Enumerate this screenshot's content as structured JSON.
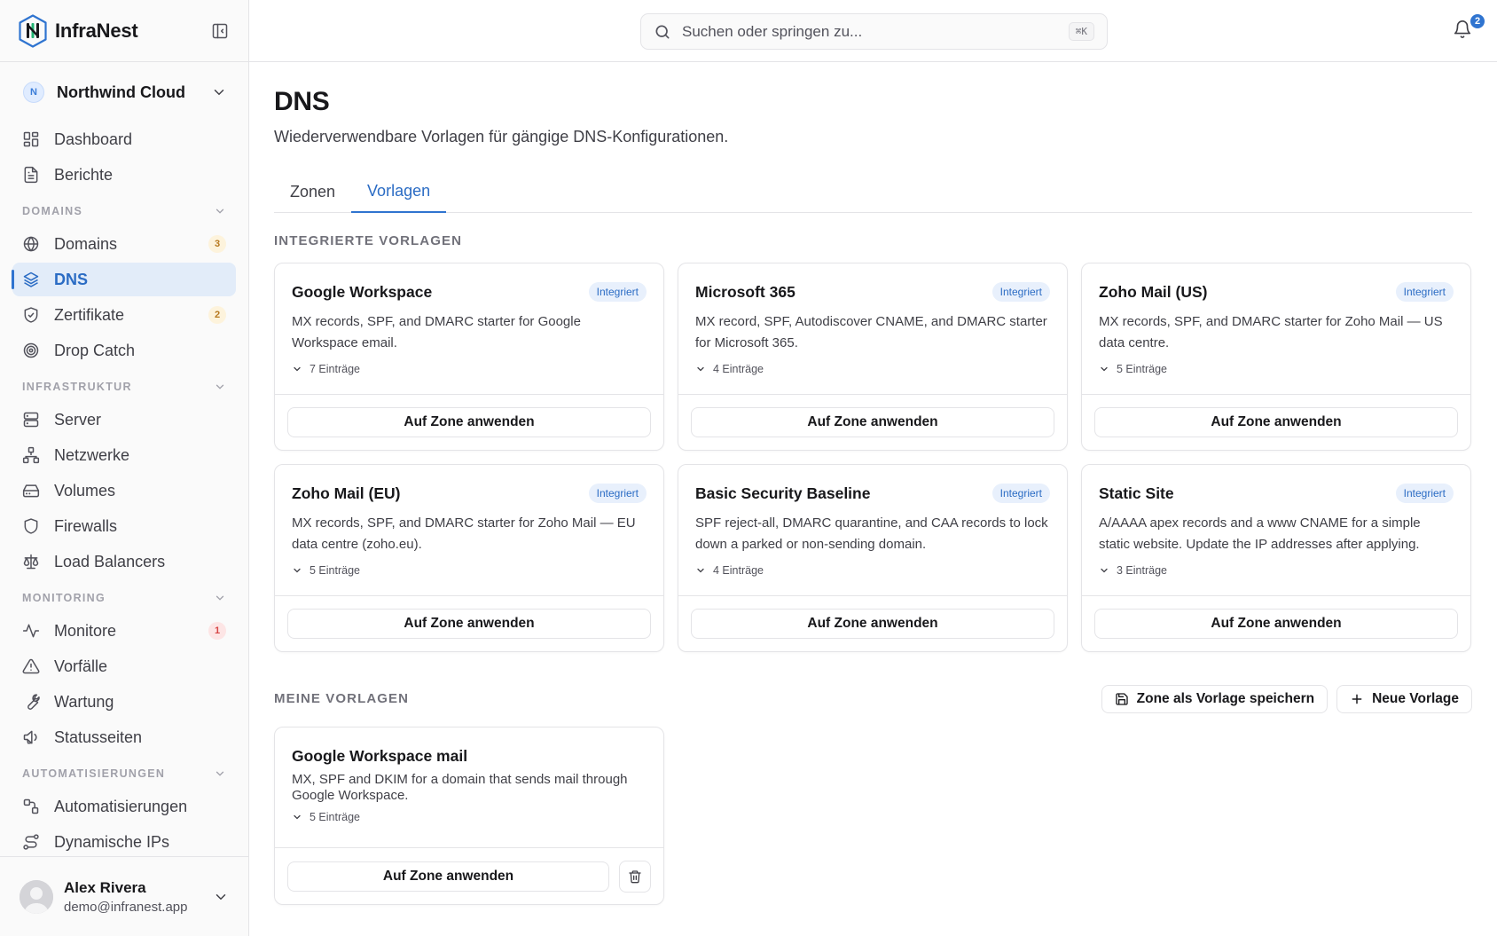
{
  "app": {
    "name": "InfraNest"
  },
  "org": {
    "initial": "N",
    "name": "Northwind Cloud"
  },
  "nav": {
    "top": [
      {
        "label": "Dashboard",
        "icon": "dashboard-icon"
      },
      {
        "label": "Berichte",
        "icon": "document-icon"
      }
    ],
    "sections": [
      {
        "title": "DOMAINS",
        "items": [
          {
            "label": "Domains",
            "icon": "globe-icon",
            "badge": "3",
            "badge_color": "amber"
          },
          {
            "label": "DNS",
            "icon": "layers-icon",
            "active": true
          },
          {
            "label": "Zertifikate",
            "icon": "shield-check-icon",
            "badge": "2",
            "badge_color": "amber"
          },
          {
            "label": "Drop Catch",
            "icon": "target-icon"
          }
        ]
      },
      {
        "title": "INFRASTRUKTUR",
        "items": [
          {
            "label": "Server",
            "icon": "server-icon"
          },
          {
            "label": "Netzwerke",
            "icon": "network-icon"
          },
          {
            "label": "Volumes",
            "icon": "hard-drive-icon"
          },
          {
            "label": "Firewalls",
            "icon": "shield-icon"
          },
          {
            "label": "Load Balancers",
            "icon": "scale-icon"
          }
        ]
      },
      {
        "title": "MONITORING",
        "items": [
          {
            "label": "Monitore",
            "icon": "activity-icon",
            "badge": "1",
            "badge_color": "red"
          },
          {
            "label": "Vorfälle",
            "icon": "alert-triangle-icon"
          },
          {
            "label": "Wartung",
            "icon": "wrench-icon"
          },
          {
            "label": "Statusseiten",
            "icon": "megaphone-icon"
          }
        ]
      },
      {
        "title": "AUTOMATISIERUNGEN",
        "items": [
          {
            "label": "Automatisierungen",
            "icon": "workflow-icon"
          },
          {
            "label": "Dynamische IPs",
            "icon": "route-icon"
          }
        ]
      }
    ]
  },
  "user": {
    "name": "Alex Rivera",
    "email": "demo@infranest.app"
  },
  "topbar": {
    "search_placeholder": "Suchen oder springen zu...",
    "shortcut": "⌘K",
    "notifications": "2"
  },
  "page": {
    "title": "DNS",
    "subtitle": "Wiederverwendbare Vorlagen für gängige DNS-Konfigurationen.",
    "tabs": [
      {
        "label": "Zonen"
      },
      {
        "label": "Vorlagen",
        "active": true
      }
    ]
  },
  "builtin": {
    "label": "INTEGRIERTE VORLAGEN",
    "badge": "Integriert",
    "apply_label": "Auf Zone anwenden",
    "templates": [
      {
        "title": "Google Workspace",
        "desc": "MX records, SPF, and DMARC starter for Google Workspace email.",
        "entries": "7 Einträge"
      },
      {
        "title": "Microsoft 365",
        "desc": "MX record, SPF, Autodiscover CNAME, and DMARC starter for Microsoft 365.",
        "entries": "4 Einträge"
      },
      {
        "title": "Zoho Mail (US)",
        "desc": "MX records, SPF, and DMARC starter for Zoho Mail — US data centre.",
        "entries": "5 Einträge"
      },
      {
        "title": "Zoho Mail (EU)",
        "desc": "MX records, SPF, and DMARC starter for Zoho Mail — EU data centre (zoho.eu).",
        "entries": "5 Einträge"
      },
      {
        "title": "Basic Security Baseline",
        "desc": "SPF reject-all, DMARC quarantine, and CAA records to lock down a parked or non-sending domain.",
        "entries": "4 Einträge"
      },
      {
        "title": "Static Site",
        "desc": "A/AAAA apex records and a www CNAME for a simple static website. Update the IP addresses after applying.",
        "entries": "3 Einträge"
      }
    ]
  },
  "mine": {
    "label": "MEINE VORLAGEN",
    "save_label": "Zone als Vorlage speichern",
    "new_label": "Neue Vorlage",
    "templates": [
      {
        "title": "Google Workspace mail",
        "desc": "MX, SPF and DKIM for a domain that sends mail through Google Workspace.",
        "entries": "5 Einträge",
        "apply_label": "Auf Zone anwenden"
      }
    ]
  },
  "colors": {
    "accent": "#2f74d0",
    "active_bg": "#e2ecf9",
    "badge_amber": "#b7791f",
    "badge_red": "#d64545"
  }
}
